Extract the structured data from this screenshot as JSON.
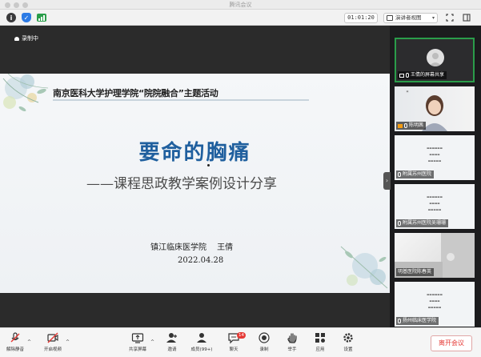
{
  "window": {
    "title": "腾讯会议"
  },
  "toolbar": {
    "timer": "01:01:20",
    "view_label": "演讲者视图"
  },
  "recording": {
    "label": "录制中"
  },
  "slide": {
    "header": "南京医科大学护理学院“院院融合”主题活动",
    "title": "要命的胸痛",
    "subtitle": "——课程思政教学案例设计分享",
    "org": "镇江临床医学院　 王倩",
    "date": "2022.04.28"
  },
  "participants": [
    {
      "label": "王倩的屏幕共享"
    },
    {
      "label": "陈明茜"
    },
    {
      "label": "附属苏州医院"
    },
    {
      "label": "附属苏州医院吴珊珊"
    },
    {
      "label": "明基医院陈春英"
    },
    {
      "label": "扬州临床医学院"
    }
  ],
  "bottom_bar": {
    "items": [
      {
        "label": "解除静音",
        "icon": "mic-muted-icon"
      },
      {
        "label": "开启视频",
        "icon": "video-off-icon"
      },
      {
        "label": "共享屏幕",
        "icon": "share-screen-icon"
      },
      {
        "label": "邀请",
        "icon": "invite-icon"
      },
      {
        "label": "成员(99+)",
        "icon": "members-icon"
      },
      {
        "label": "聊天",
        "icon": "chat-icon",
        "badge": "14"
      },
      {
        "label": "录制",
        "icon": "record-icon"
      },
      {
        "label": "举手",
        "icon": "raise-hand-icon"
      },
      {
        "label": "应用",
        "icon": "apps-icon"
      },
      {
        "label": "设置",
        "icon": "settings-icon"
      }
    ],
    "leave_label": "离开会议"
  },
  "colors": {
    "slide_title": "#1f5f9e",
    "active_speaker": "#2a9d4a",
    "leave": "#e53935",
    "shield": "#2d7be5",
    "signal": "#2a9d4a"
  }
}
